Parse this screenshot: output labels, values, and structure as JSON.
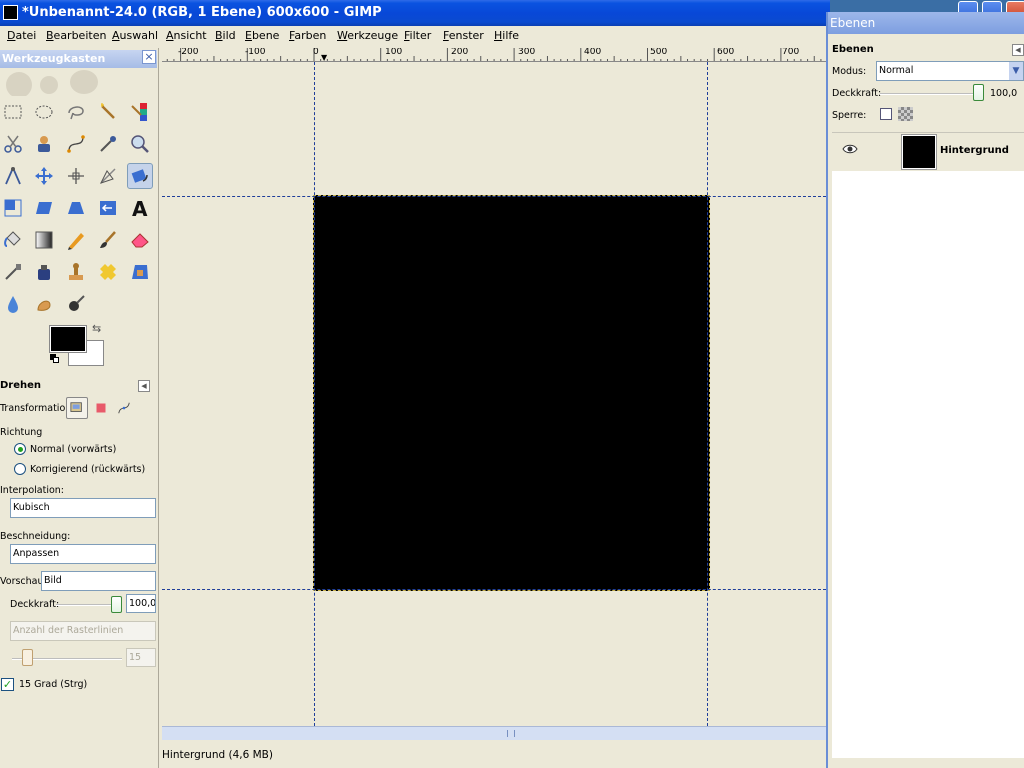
{
  "window": {
    "title": "*Unbenannt-24.0 (RGB, 1 Ebene) 600x600 - GIMP"
  },
  "menu": [
    "Datei",
    "Bearbeiten",
    "Auswahl",
    "Ansicht",
    "Bild",
    "Ebene",
    "Farben",
    "Werkzeuge",
    "Filter",
    "Fenster",
    "Hilfe"
  ],
  "ruler": {
    "ticks": [
      "-200",
      "-100",
      "0",
      "100",
      "200",
      "300",
      "400",
      "500",
      "600",
      "700"
    ]
  },
  "toolbox": {
    "title": "Werkzeugkasten",
    "tools": [
      "rect-select-icon",
      "ellipse-select-icon",
      "free-select-icon",
      "fuzzy-select-icon",
      "color-select-icon",
      "scissors-icon",
      "foreground-select-icon",
      "paths-icon",
      "color-picker-icon",
      "zoom-icon",
      "measure-icon",
      "move-icon",
      "align-icon",
      "crop-icon",
      "rotate-icon",
      "scale-icon",
      "shear-icon",
      "perspective-icon",
      "flip-icon",
      "text-icon",
      "bucket-fill-icon",
      "blend-icon",
      "pencil-icon",
      "paintbrush-icon",
      "eraser-icon",
      "airbrush-icon",
      "ink-icon",
      "clone-icon",
      "heal-icon",
      "perspective-clone-icon",
      "blur-icon",
      "smudge-icon",
      "dodge-burn-icon"
    ],
    "active_tool": "rotate-icon",
    "colors": {
      "foreground": "#000000",
      "background": "#ffffff"
    }
  },
  "tool_options": {
    "title": "Drehen",
    "transformation_label": "Transformation:",
    "direction_label": "Richtung",
    "direction_normal": "Normal (vorwärts)",
    "direction_corrective": "Korrigierend (rückwärts)",
    "direction_selected": "normal",
    "interpolation_label": "Interpolation:",
    "interpolation_value": "Kubisch",
    "clipping_label": "Beschneidung:",
    "clipping_value": "Anpassen",
    "preview_label": "Vorschau:",
    "preview_value": "Bild",
    "opacity_label": "Deckkraft:",
    "opacity_value": "100,0",
    "grid_lines_placeholder": "Anzahl der Rasterlinien",
    "grid_lines_value": "15",
    "constrain_label": "15 Grad (Strg)",
    "constrain_checked": true
  },
  "status": {
    "text": "Hintergrund (4,6 MB)"
  },
  "layers": {
    "window_title": "Ebenen",
    "panel_title": "Ebenen",
    "mode_label": "Modus:",
    "mode_value": "Normal",
    "opacity_label": "Deckkraft:",
    "opacity_value": "100,0",
    "lock_label": "Sperre:",
    "items": [
      {
        "name": "Hintergrund",
        "visible": true,
        "color": "#000000"
      }
    ]
  }
}
